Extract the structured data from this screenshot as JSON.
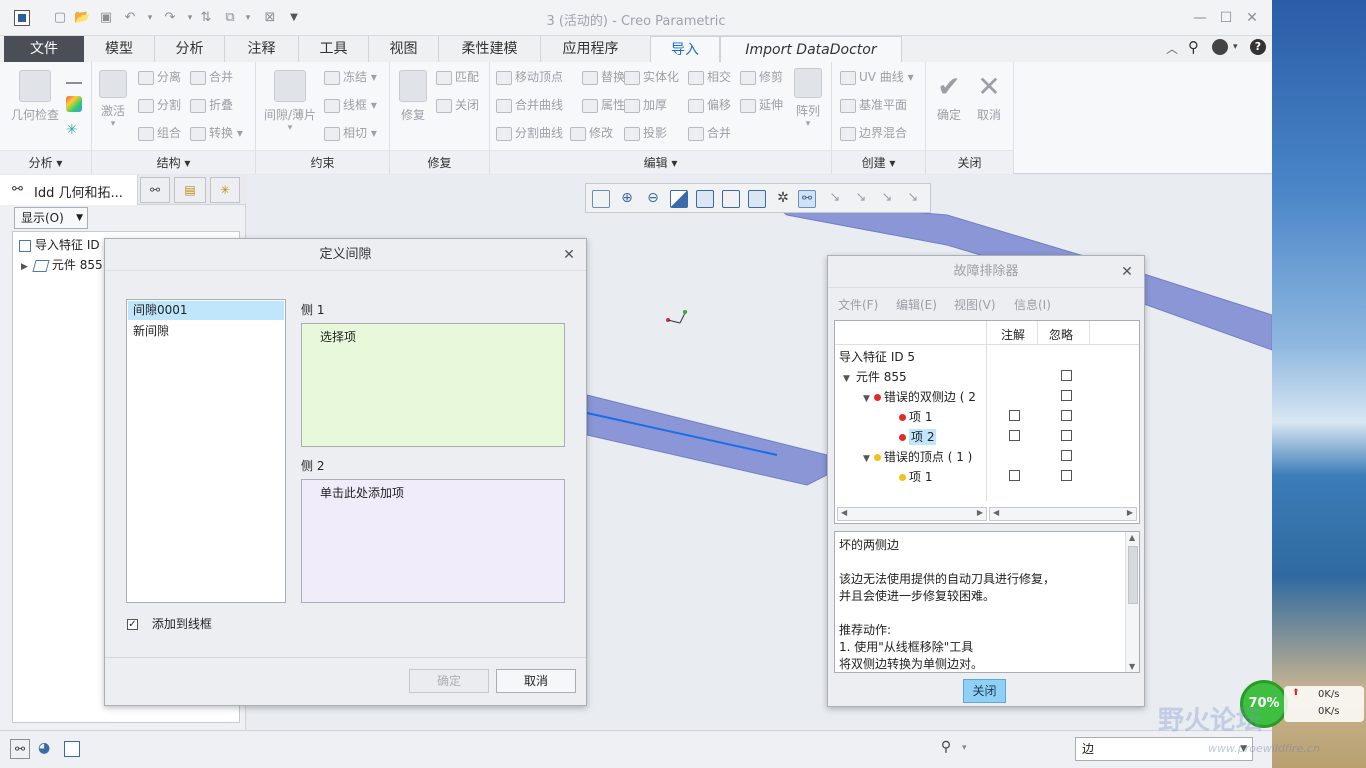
{
  "window": {
    "title": "3 (活动的) - Creo Parametric",
    "minimize": "—",
    "maximize": "☐",
    "close": "✕"
  },
  "quick_access": [
    "new-icon",
    "open-icon",
    "save-icon",
    "undo-icon",
    "redo-icon",
    "regenerate-icon",
    "windows-icon",
    "close-window-icon",
    "more-icon"
  ],
  "menu_tabs": {
    "file": "文件",
    "model": "模型",
    "analysis": "分析",
    "annotate": "注释",
    "tools": "工具",
    "view": "视图",
    "flexible": "柔性建模",
    "apps": "应用程序",
    "import": "导入",
    "import_datadoctor": "Import DataDoctor"
  },
  "ribbon": {
    "geometry_check": "几何检查",
    "activate": "激活",
    "separate": "分离",
    "merge": "合并",
    "split": "分割",
    "fold": "折叠",
    "group": "组合",
    "convert": "转换",
    "gap_sheet": "间隙/薄片",
    "freeze": "冻结",
    "wireframe": "线框",
    "tangent": "相切",
    "repair": "修复",
    "match": "匹配",
    "close": "关闭",
    "move_vertex": "移动顶点",
    "replace": "替换",
    "solidify": "实体化",
    "intersect": "相交",
    "trim": "修剪",
    "merge_curves": "合并曲线",
    "attributes": "属性",
    "thicken": "加厚",
    "offset": "偏移",
    "extend": "延伸",
    "split_curves": "分割曲线",
    "modify": "修改",
    "project": "投影",
    "combine": "合并",
    "pattern": "阵列",
    "uv_curve": "UV 曲线",
    "datum_plane": "基准平面",
    "boundary_blend": "边界混合",
    "ok": "确定",
    "cancel": "取消",
    "groups": {
      "analysis": "分析",
      "structure": "结构",
      "constraint": "约束",
      "repair": "修复",
      "edit": "编辑",
      "create": "创建",
      "close": "关闭"
    }
  },
  "left_panel": {
    "tab_title": "Idd 几何和拓...",
    "display_button": "显示(O)",
    "tree": [
      "导入特征 ID",
      "元件 855"
    ]
  },
  "gap_dialog": {
    "title": "定义间隙",
    "list": [
      "间隙0001",
      "新间隙"
    ],
    "side1_label": "侧 1",
    "side1_text": "选择项",
    "side2_label": "侧 2",
    "side2_text": "单击此处添加项",
    "add_to_wireframe": "添加到线框",
    "ok": "确定",
    "cancel": "取消"
  },
  "troubleshooter": {
    "title": "故障排除器",
    "menu": [
      "文件(F)",
      "编辑(E)",
      "视图(V)",
      "信息(I)"
    ],
    "col_note": "注解",
    "col_ignore": "忽略",
    "rows": [
      "导入特征 ID 5",
      "元件 855",
      "错误的双侧边 ( 2",
      "项 1",
      "项 2",
      "错误的顶点 ( 1 )",
      "项 1"
    ],
    "message_title": "坏的两侧边",
    "message_line1": "该边无法使用提供的自动刀具进行修复，",
    "message_line2": "并且会使进一步修复较困难。",
    "message_line3": "推荐动作:",
    "message_line4": "1. 使用\"从线框移除\"工具",
    "message_line5": "将双侧边转换为单侧边对。",
    "close": "关闭"
  },
  "status_bar": {
    "filter": "边"
  },
  "overlay": {
    "percent": "70%",
    "up": "0K/s",
    "down": "0K/s",
    "watermark": "野火论坛",
    "watermark_url": "www.proewildfire.cn"
  },
  "colors": {
    "accent": "#1a6ec8",
    "highlight": "#bfe6fb",
    "side1_bg": "#e8f8da",
    "side2_bg": "#f1ecfa",
    "model_surface": "#8a96d6",
    "error_red": "#e02b2b",
    "warn_yellow": "#f2c21a"
  }
}
